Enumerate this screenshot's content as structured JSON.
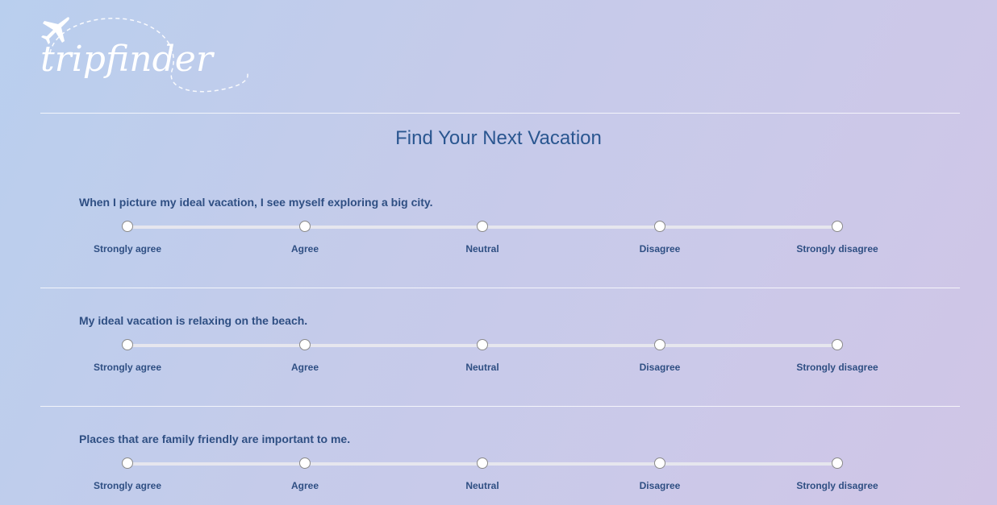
{
  "logo": {
    "text": "tripfinder",
    "icon": "airplane-icon"
  },
  "page": {
    "title": "Find Your Next Vacation"
  },
  "questions": [
    {
      "text": "When I picture my ideal vacation, I see myself exploring a big city.",
      "options": [
        "Strongly agree",
        "Agree",
        "Neutral",
        "Disagree",
        "Strongly disagree"
      ],
      "selected": null
    },
    {
      "text": "My ideal vacation is relaxing on the beach.",
      "options": [
        "Strongly agree",
        "Agree",
        "Neutral",
        "Disagree",
        "Strongly disagree"
      ],
      "selected": null
    },
    {
      "text": "Places that are family friendly are important to me.",
      "options": [
        "Strongly agree",
        "Agree",
        "Neutral",
        "Disagree",
        "Strongly disagree"
      ],
      "selected": null
    }
  ],
  "colors": {
    "text": "#2f4f83",
    "title": "#2a5690",
    "track": "#e6e6ee"
  }
}
